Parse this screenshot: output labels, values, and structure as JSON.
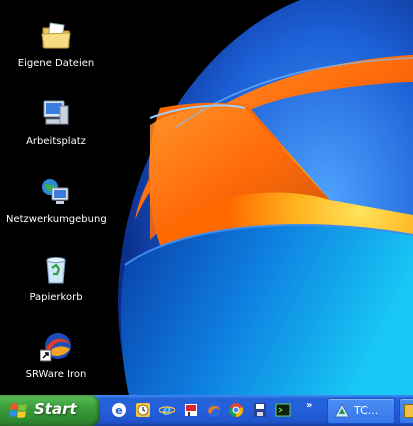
{
  "desktop": {
    "icons": [
      {
        "label": "Eigene Dateien",
        "icon": "folder-documents-icon"
      },
      {
        "label": "Arbeitsplatz",
        "icon": "my-computer-icon"
      },
      {
        "label": "Netzwerkumgebung",
        "icon": "network-places-icon"
      },
      {
        "label": "Papierkorb",
        "icon": "recycle-bin-icon"
      },
      {
        "label": "SRWare Iron",
        "icon": "browser-shortcut-icon"
      }
    ]
  },
  "taskbar": {
    "start_label": "Start",
    "quick_launch": [
      "outlook-express-icon",
      "clock-icon",
      "internet-explorer-icon",
      "app-icon",
      "firefox-icon",
      "chrome-icon",
      "floppy-save-icon",
      "terminal-icon"
    ],
    "tray_arrow": "»",
    "tasks": [
      {
        "label": "TC...",
        "icon": "task-app-icon"
      }
    ]
  },
  "colors": {
    "taskbar_blue": "#245edc",
    "start_green": "#3a9d3a",
    "wallpaper_orange": "#ff7a10"
  }
}
